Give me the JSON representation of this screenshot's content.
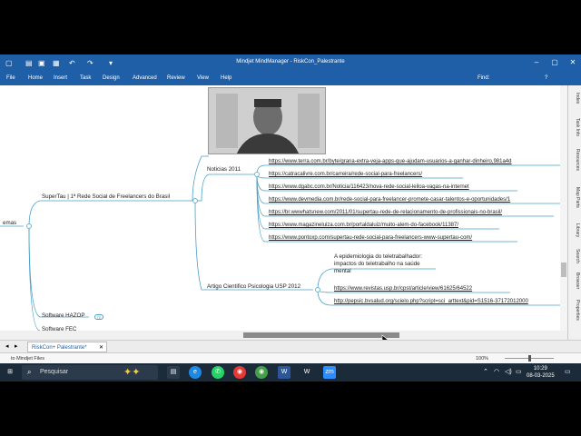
{
  "window": {
    "title": "Mindjet MindManager - RiskCon_Palestrante"
  },
  "menu": {
    "items": [
      "File",
      "Home",
      "Insert",
      "Task",
      "Design",
      "Advanced",
      "Review",
      "View",
      "Help"
    ],
    "find_label": "Find:"
  },
  "map": {
    "left_partial_topic": "emas",
    "branch_main": "SuperTau | 1ª Rede Social de Freelancers do Brasil",
    "branch_noticias": "Noticias 2011",
    "noticias_links": [
      "https://www.terra.com.br/byte/grana-extra-veja-apps-que-ajudam-usuarios-a-ganhar-dinheiro,981a4d",
      "https://catracalivre.com.br/carreira/rede-social-para-freelancers/",
      "https://www.dgabc.com.br/Noticia/116423/nova-rede-social-leiloa-vagas-na-internet",
      "https://www.devmedia.com.br/rede-social-para-freelancer-promete-casar-talentos-e-oportunidades/1",
      "https://br.wwwhatsnew.com/2011/01/supertau-rede-de-relacionamento-de-profissionais-no-brasil/",
      "https://www.magazineluiza.com.br/portaldaluiz/muito-alem-do-facebook/11387/",
      "https://www.pontoxp.com/supertau-rede-social-para-freelancers-www-supertau-com/"
    ],
    "branch_artigo": "Artigo Cientifico Psicologia USP 2012",
    "artigo_title_line1": "A epidemiologia do teletrabalhador:",
    "artigo_title_line2": "impactos do teletrabalho na saúde",
    "artigo_title_line3": "mental",
    "artigo_links": [
      "https://www.revistas.usp.br/cpst/article/view/61625/64522",
      "http://pepsic.bvsalud.org/scielo.php?script=sci_arttext&pid=S1516-37172012000"
    ],
    "branch_software": "Software HAZOP",
    "software_badge": "TE",
    "branch_partial_bottom": "Software FEC"
  },
  "side_panel": {
    "tabs": [
      "Index",
      "Task Info",
      "Resources",
      "Map Parts",
      "Library",
      "Search",
      "Browser",
      "Properties"
    ]
  },
  "doc_tabs": {
    "active": "RiskCon+ Palestrante*"
  },
  "status": {
    "left_text": "to Mindjet Files",
    "zoom": "100%"
  },
  "taskbar": {
    "search_placeholder": "Pesquisar",
    "time": "10:29",
    "date": "08-03-2025"
  },
  "colors": {
    "titlebar": "#1f5fa8",
    "taskbar": "#1c2b3a",
    "branch_line": "#4aa0c8"
  }
}
